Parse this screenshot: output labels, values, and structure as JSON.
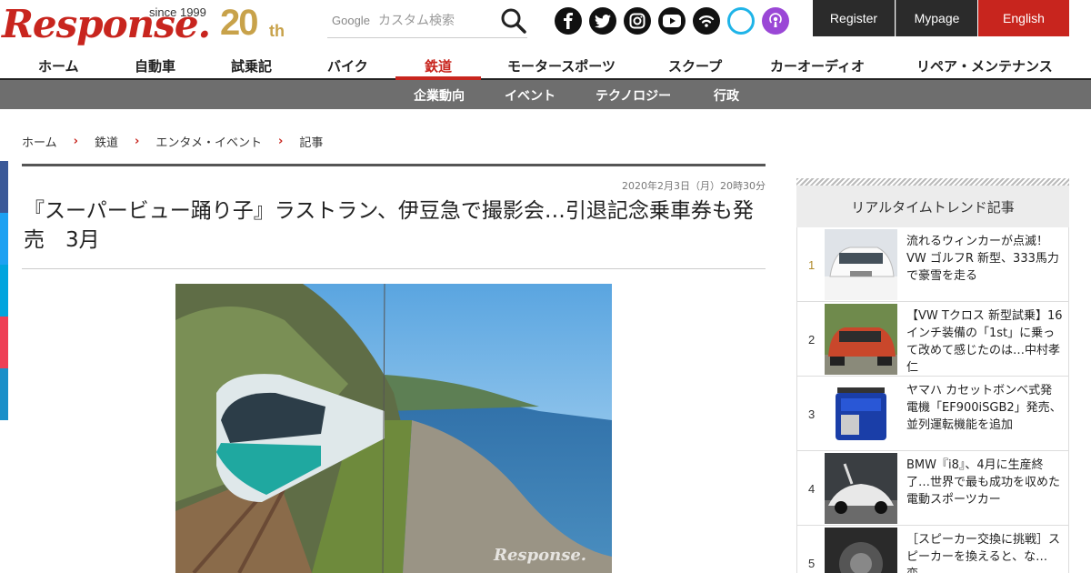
{
  "header": {
    "logo_text": "Response.",
    "logo_since": "since 1999",
    "logo_anniversary": "20",
    "logo_anniversary_suffix": "th",
    "search_brand": "Google",
    "search_placeholder": "カスタム検索",
    "social_icons": [
      "facebook-icon",
      "twitter-icon",
      "instagram-icon",
      "youtube-icon",
      "rss-icon",
      "alexa-icon",
      "podcast-icon"
    ],
    "register_label": "Register",
    "mypage_label": "Mypage",
    "english_label": "English"
  },
  "colors": {
    "accent": "#c8251e",
    "gold": "#c8a24a",
    "subnav": "#6e6e6e"
  },
  "nav": {
    "items": [
      "ホーム",
      "自動車",
      "試乗記",
      "バイク",
      "鉄道",
      "モータースポーツ",
      "スクープ",
      "カーオーディオ",
      "リペア・メンテナンス"
    ],
    "active": "鉄道"
  },
  "subnav": {
    "items": [
      "企業動向",
      "イベント",
      "テクノロジー",
      "行政"
    ]
  },
  "breadcrumb": [
    "ホーム",
    "鉄道",
    "エンタメ・イベント",
    "記事"
  ],
  "article": {
    "date": "2020年2月3日（月）20時30分",
    "title": "『スーパービュー踊り子』ラストラン、伊豆急で撮影会…引退記念乗車券も発売　3月",
    "photo_watermark": "Response."
  },
  "sidebar": {
    "heading": "リアルタイムトレンド記事",
    "items": [
      {
        "rank": "1",
        "text": "流れるウィンカーが点滅！VW ゴルフR 新型、333馬力で豪雪を走る"
      },
      {
        "rank": "2",
        "text": "【VW Tクロス 新型試乗】16インチ装備の「1st」に乗って改めて感じたのは…中村孝仁"
      },
      {
        "rank": "3",
        "text": "ヤマハ カセットボンベ式発電機「EF900iSGB2」発売、並列運転機能を追加"
      },
      {
        "rank": "4",
        "text": "BMW『i8』、4月に生産終了…世界で最も成功を収めた電動スポーツカー"
      },
      {
        "rank": "5",
        "text": "［スピーカー交換に挑戦］スピーカーを換えると、な…変…"
      }
    ]
  }
}
